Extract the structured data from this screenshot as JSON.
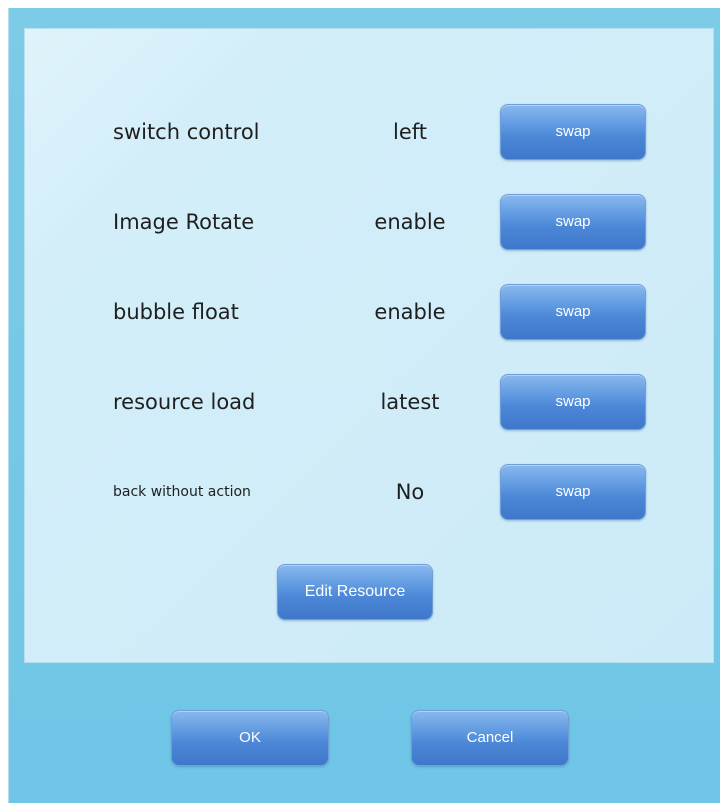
{
  "settings": {
    "rows": [
      {
        "label": "switch control",
        "value": "left",
        "button": "swap"
      },
      {
        "label": "Image Rotate",
        "value": "enable",
        "button": "swap"
      },
      {
        "label": "bubble float",
        "value": "enable",
        "button": "swap"
      },
      {
        "label": "resource load",
        "value": "latest",
        "button": "swap"
      },
      {
        "label": "back without action",
        "value": "No",
        "button": "swap"
      }
    ],
    "edit_resource_label": "Edit Resource"
  },
  "footer": {
    "ok_label": "OK",
    "cancel_label": "Cancel"
  },
  "colors": {
    "dialog_bg": "#6fc6e6",
    "panel_bg": "#d3eef9",
    "button_top": "#8ab8ee",
    "button_bottom": "#3f78cb",
    "text": "#1f1f1f"
  }
}
